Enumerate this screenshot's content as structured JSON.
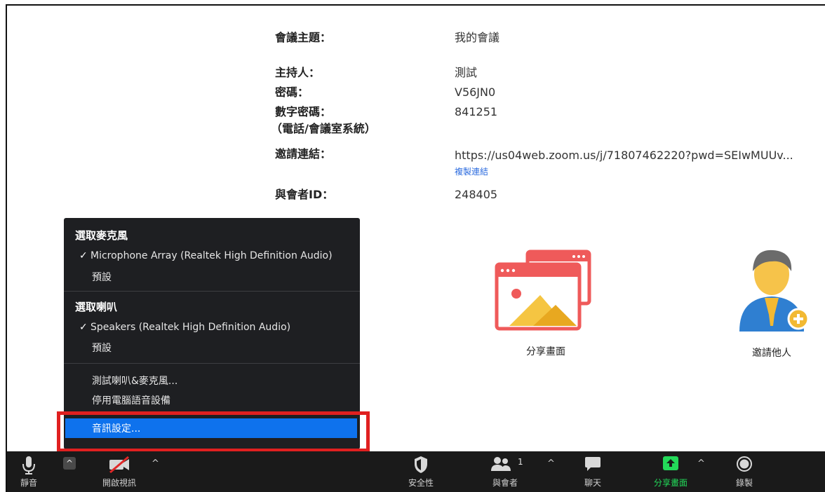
{
  "meeting": {
    "topic_label": "會議主題：",
    "topic_value": "我的會議",
    "host_label": "主持人：",
    "host_value": "測試",
    "password_label": "密碼：",
    "password_value": "V56JN0",
    "numeric_password_label": "數字密碼：",
    "numeric_password_sub": "（電話/會議室系統）",
    "numeric_password_value": "841251",
    "invite_link_label": "邀請連結：",
    "invite_link_value": "https://us04web.zoom.us/j/71807462220?pwd=SEIwMUUv...",
    "copy_link": "複製連結",
    "participant_id_label": "與會者ID：",
    "participant_id_value": "248405"
  },
  "tiles": {
    "share_label": "分享畫面",
    "invite_label": "邀請他人"
  },
  "audio_menu": {
    "mic_heading": "選取麥克風",
    "mic_selected": "Microphone Array (Realtek High Definition Audio)",
    "mic_default": "預設",
    "speaker_heading": "選取喇叭",
    "speaker_selected": "Speakers (Realtek High Definition Audio)",
    "speaker_default": "預設",
    "test_audio": "測試喇叭&麥克風...",
    "leave_audio": "停用電腦語音設備",
    "audio_settings": "音訊設定...",
    "check_mark": "✓"
  },
  "toolbar": {
    "mute_label": "靜音",
    "video_label": "開啟視訊",
    "security_label": "安全性",
    "participants_label": "與會者",
    "participants_count": "1",
    "chat_label": "聊天",
    "share_label": "分享畫面",
    "record_label": "錄製",
    "caret": "^"
  },
  "colors": {
    "toolbar_bg": "#1a1a1a",
    "menu_bg": "#1e1f22",
    "highlight": "#0e72ed",
    "share_green": "#23d959",
    "red_box": "#e02020",
    "tile_red": "#ef5a5a"
  }
}
